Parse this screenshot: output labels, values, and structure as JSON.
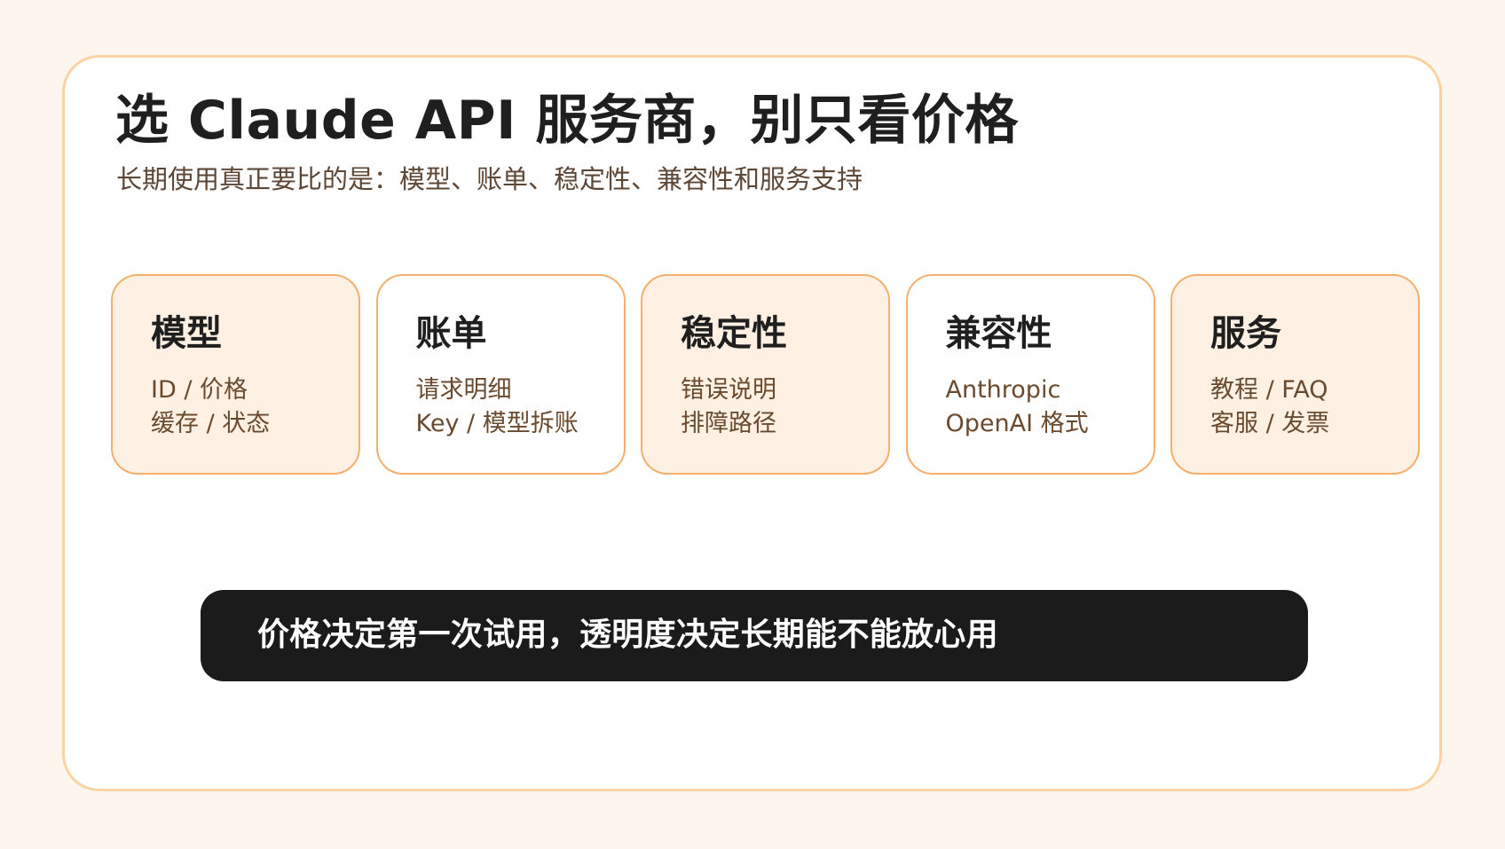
{
  "colors": {
    "page_background": "#fcf6ef",
    "card_border": "#f9d3a2",
    "feature_border": "#f4b06c",
    "feature_tint": "#fef1e4",
    "title_text": "#1f1f1f",
    "subtitle_text": "#5c4636",
    "feature_text": "#6a4a2f",
    "banner_background": "#1b1b1b",
    "banner_text": "#ffffff"
  },
  "header": {
    "title": "选 Claude API 服务商，别只看价格",
    "subtitle": "长期使用真正要比的是：模型、账单、稳定性、兼容性和服务支持"
  },
  "features": [
    {
      "title": "模型",
      "tinted": true,
      "lines": [
        "ID / 价格",
        "缓存 / 状态"
      ]
    },
    {
      "title": "账单",
      "tinted": false,
      "lines": [
        "请求明细",
        "Key / 模型拆账"
      ]
    },
    {
      "title": "稳定性",
      "tinted": true,
      "lines": [
        "错误说明",
        "排障路径"
      ]
    },
    {
      "title": "兼容性",
      "tinted": false,
      "lines": [
        "Anthropic",
        "OpenAI 格式"
      ]
    },
    {
      "title": "服务",
      "tinted": true,
      "lines": [
        "教程 / FAQ",
        "客服 / 发票"
      ]
    }
  ],
  "banner": {
    "text": "价格决定第一次试用，透明度决定长期能不能放心用"
  }
}
